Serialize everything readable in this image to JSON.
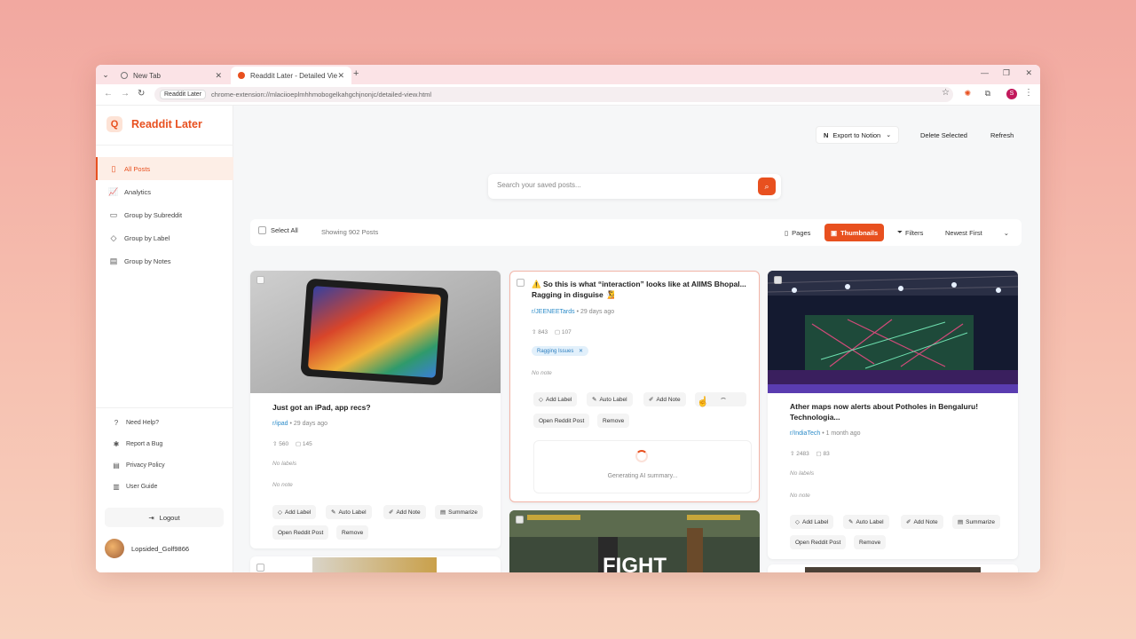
{
  "browser": {
    "tabs": [
      {
        "label": "New Tab",
        "active": false
      },
      {
        "label": "Readdit Later - Detailed View",
        "active": true
      }
    ],
    "chip_label": "Readdit Later",
    "url": "chrome-extension://mlaciioeplmhhmobogelkahgchjnonjc/detailed-view.html",
    "profile_initial": "S"
  },
  "sidebar": {
    "brand": "Readdit Later",
    "logo_letter": "Q",
    "nav": [
      {
        "label": "All Posts",
        "icon": "bookmark-icon",
        "active": true
      },
      {
        "label": "Analytics",
        "icon": "chart-icon",
        "active": false
      },
      {
        "label": "Group by Subreddit",
        "icon": "folder-icon",
        "active": false
      },
      {
        "label": "Group by Label",
        "icon": "tag-icon",
        "active": false
      },
      {
        "label": "Group by Notes",
        "icon": "book-icon",
        "active": false
      }
    ],
    "support": [
      {
        "label": "Need Help?",
        "icon": "help-icon"
      },
      {
        "label": "Report a Bug",
        "icon": "bug-icon"
      },
      {
        "label": "Privacy Policy",
        "icon": "document-icon"
      },
      {
        "label": "User Guide",
        "icon": "book-open-icon"
      }
    ],
    "logout": "Logout",
    "username": "Lopsided_Golf9866"
  },
  "header": {
    "export": "Export to Notion",
    "delete": "Delete Selected",
    "refresh": "Refresh"
  },
  "search": {
    "placeholder": "Search your saved posts..."
  },
  "toolbar": {
    "select_all": "Select All",
    "showing": "Showing 902 Posts",
    "pages": "Pages",
    "thumbnails": "Thumbnails",
    "filters": "Filters",
    "sort": "Newest First"
  },
  "actions": {
    "add_label": "Add Label",
    "auto_label": "Auto Label",
    "add_note": "Add Note",
    "summarize": "Summarize",
    "open": "Open Reddit Post",
    "remove": "Remove"
  },
  "posts": [
    {
      "title": "Just got an iPad, app recs?",
      "subreddit": "r/ipad",
      "age": "• 29 days ago",
      "upvotes": "560",
      "comments": "145",
      "labels_text": "No labels",
      "note": "No note"
    },
    {
      "title": "⚠️ So this is what “interaction” looks like at AIIMS Bhopal... Ragging in disguise 🧏",
      "subreddit": "r/JEENEETards",
      "age": "• 29 days ago",
      "upvotes": "843",
      "comments": "107",
      "tag": "Ragging Issues",
      "note": "No note",
      "ai_status": "Generating AI summary..."
    },
    {
      "title": "Ather maps now alerts about Potholes in Bengaluru! Technologia...",
      "subreddit": "r/IndiaTech",
      "age": "• 1 month ago",
      "upvotes": "2483",
      "comments": "83",
      "labels_text": "No labels",
      "note": "No note"
    },
    {
      "thumb_text": "FIGHT"
    }
  ],
  "colors": {
    "accent": "#e8501f",
    "link": "#2d8cc9"
  }
}
